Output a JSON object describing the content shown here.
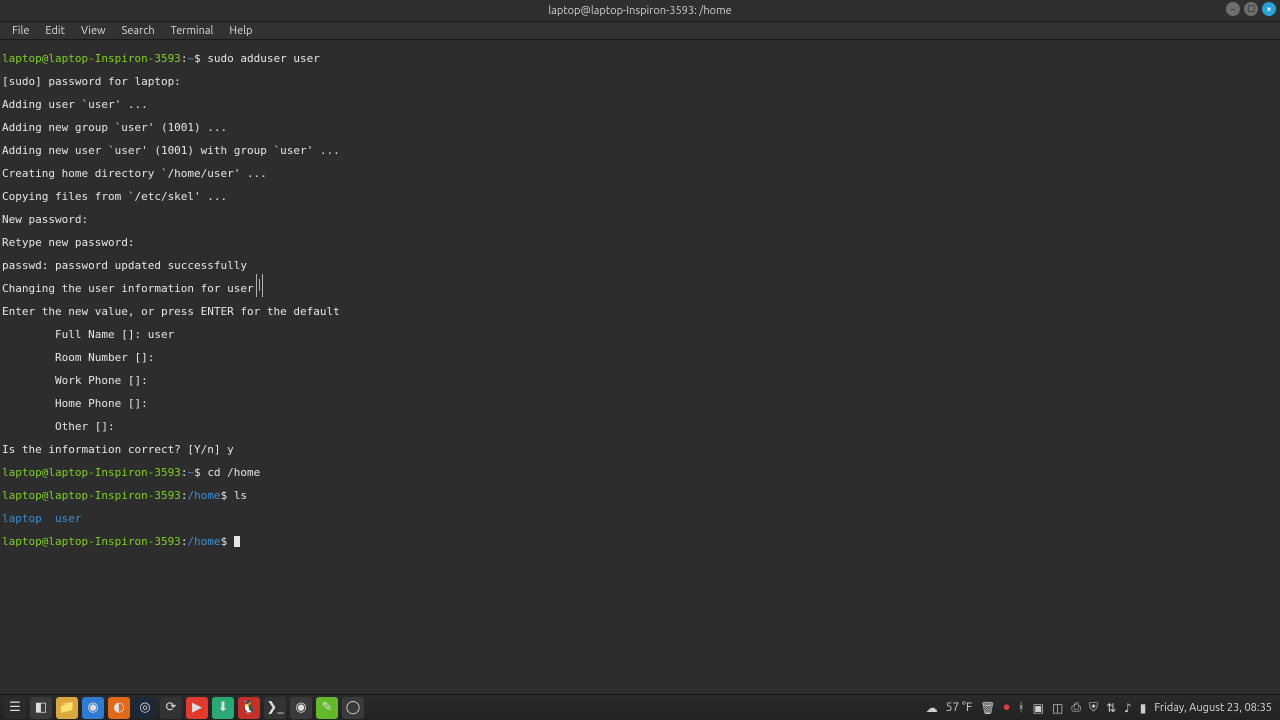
{
  "window": {
    "title": "laptop@laptop-Inspiron-3593: /home"
  },
  "menu": {
    "file": "File",
    "edit": "Edit",
    "view": "View",
    "search": "Search",
    "terminal": "Terminal",
    "help": "Help"
  },
  "prompt": {
    "user_host": "laptop@laptop-Inspiron-3593",
    "home_tilde": "~",
    "home_path": "/home"
  },
  "cmd": {
    "adduser": "sudo adduser user",
    "cd_home": "cd /home",
    "ls": "ls"
  },
  "out": {
    "sudo_pw": "[sudo] password for laptop:",
    "adding_user": "Adding user `user' ...",
    "adding_group": "Adding new group `user' (1001) ...",
    "adding_new_user": "Adding new user `user' (1001) with group `user' ...",
    "creating_home": "Creating home directory `/home/user' ...",
    "copying_skel": "Copying files from `/etc/skel' ...",
    "new_pw": "New password:",
    "retype_pw": "Retype new password:",
    "pw_success": "passwd: password updated successfully",
    "changing_info": "Changing the user information for user",
    "enter_default": "Enter the new value, or press ENTER for the default",
    "fullname": "        Full Name []: user",
    "room": "        Room Number []:",
    "workphone": "        Work Phone []:",
    "homephone": "        Home Phone []:",
    "other": "        Other []:",
    "confirm": "Is the information correct? [Y/n] y",
    "ls_out1": "laptop",
    "ls_out2": "user"
  },
  "taskbar_icons": [
    {
      "name": "menu-icon",
      "glyph": "☰",
      "bg": "#2b2b2b"
    },
    {
      "name": "show-desktop-icon",
      "glyph": "◧",
      "bg": "#3b3b3b"
    },
    {
      "name": "files-icon",
      "glyph": "📁",
      "bg": "#d9a63f"
    },
    {
      "name": "chrome-icon",
      "glyph": "◉",
      "bg": "#2e7bd1"
    },
    {
      "name": "firefox-icon",
      "glyph": "◐",
      "bg": "#e06a1a"
    },
    {
      "name": "steam-icon",
      "glyph": "◎",
      "bg": "#1b2838"
    },
    {
      "name": "pulse-icon",
      "glyph": "⟳",
      "bg": "#333"
    },
    {
      "name": "media-icon",
      "glyph": "▶",
      "bg": "#e23b2e"
    },
    {
      "name": "software-icon",
      "glyph": "⬇",
      "bg": "#2aa876"
    },
    {
      "name": "tux-icon",
      "glyph": "🐧",
      "bg": "#c6302b"
    },
    {
      "name": "terminal-icon",
      "glyph": "❯_",
      "bg": "#333"
    },
    {
      "name": "obs-icon",
      "glyph": "◉",
      "bg": "#3a3a3a"
    },
    {
      "name": "green-app-icon",
      "glyph": "✎",
      "bg": "#63b92b"
    },
    {
      "name": "mint-menu-icon",
      "glyph": "◯",
      "bg": "#3a3a3a"
    }
  ],
  "tray": {
    "weather": "57 °F",
    "date": "Friday, August 23, 08:35"
  }
}
